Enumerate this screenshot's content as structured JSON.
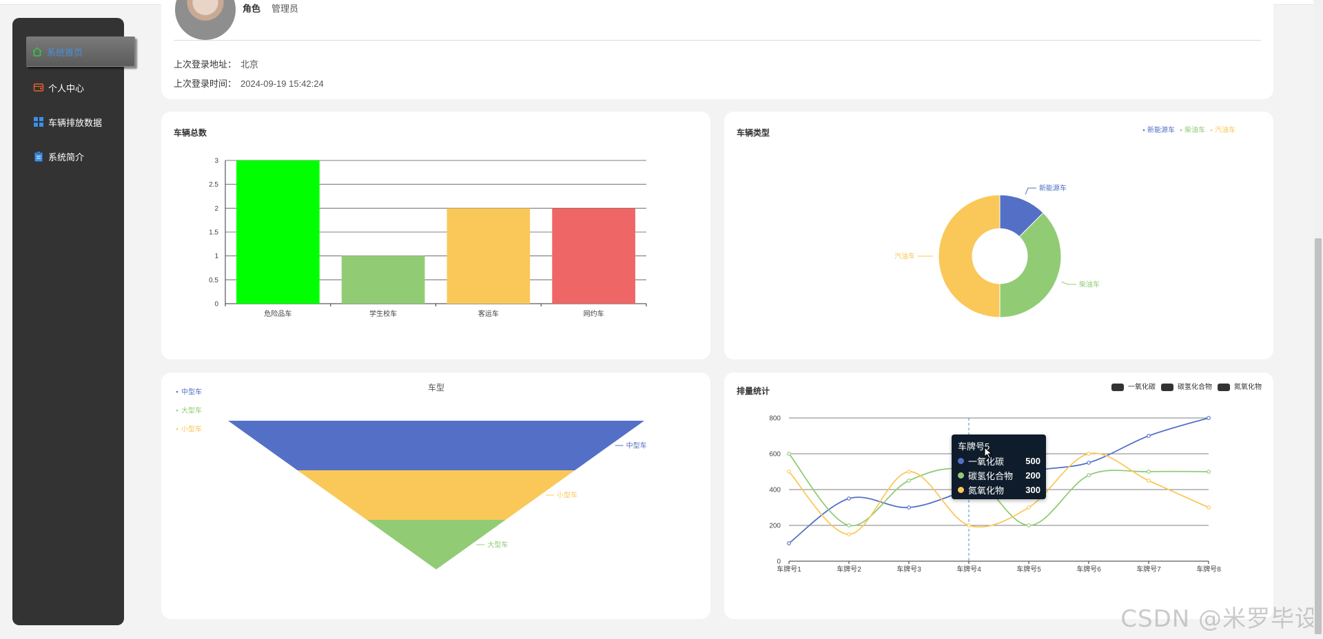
{
  "sidebar": {
    "items": [
      {
        "label": "系统首页",
        "icon": "home-icon",
        "active": true
      },
      {
        "label": "个人中心",
        "icon": "wallet-icon",
        "active": false
      },
      {
        "label": "车辆排放数据",
        "icon": "grid-icon",
        "active": false
      },
      {
        "label": "系统简介",
        "icon": "clipboard-icon",
        "active": false
      }
    ]
  },
  "profile": {
    "role_label": "角色",
    "role_value": "管理员",
    "last_login_address_label": "上次登录地址：",
    "last_login_address": "北京",
    "last_login_time_label": "上次登录时间：",
    "last_login_time": "2024-09-19 15:42:24"
  },
  "charts": {
    "vehicle_total": {
      "title": "车辆总数"
    },
    "vehicle_type": {
      "title": "车辆类型"
    },
    "model": {
      "title": "车型"
    },
    "emission": {
      "title": "排量统计"
    }
  },
  "chart_data": [
    {
      "type": "bar",
      "title": "车辆总数",
      "categories": [
        "危险品车",
        "学生校车",
        "客运车",
        "网约车"
      ],
      "values": [
        3,
        1,
        2,
        2
      ],
      "colors": [
        "#00ff00",
        "#91cc75",
        "#fac858",
        "#ee6666"
      ],
      "yticks": [
        "0",
        "0.5",
        "1",
        "1.5",
        "2",
        "2.5",
        "3"
      ],
      "ylim": [
        0,
        3
      ]
    },
    {
      "type": "pie",
      "title": "车辆类型",
      "legend": [
        "新能源车",
        "柴油车",
        "汽油车"
      ],
      "values": [
        1,
        3,
        4
      ],
      "colors": [
        "#5470c6",
        "#91cc75",
        "#fac858"
      ],
      "legend_position": "top-right"
    },
    {
      "type": "funnel",
      "title": "车型",
      "legend": [
        "中型车",
        "大型车",
        "小型车"
      ],
      "stages": [
        {
          "name": "中型车",
          "value": 3,
          "color": "#5470c6"
        },
        {
          "name": "小型车",
          "value": 2,
          "color": "#fac858"
        },
        {
          "name": "大型车",
          "value": 1,
          "color": "#91cc75"
        }
      ],
      "legend_position": "top-left"
    },
    {
      "type": "line",
      "title": "排量统计",
      "categories": [
        "车牌号1",
        "车牌号2",
        "车牌号3",
        "车牌号4",
        "车牌号5",
        "车牌号6",
        "车牌号7",
        "车牌号8"
      ],
      "yticks": [
        "0",
        "200",
        "400",
        "600",
        "800"
      ],
      "ylim": [
        0,
        800
      ],
      "series": [
        {
          "name": "一氧化碳",
          "color": "#5470c6",
          "values": [
            100,
            350,
            300,
            400,
            500,
            550,
            700,
            800
          ]
        },
        {
          "name": "碳氢化合物",
          "color": "#91cc75",
          "values": [
            600,
            200,
            450,
            500,
            200,
            480,
            500,
            500
          ]
        },
        {
          "name": "氮氧化物",
          "color": "#fac858",
          "values": [
            500,
            150,
            500,
            200,
            300,
            600,
            450,
            300
          ]
        }
      ],
      "legend_position": "top-right",
      "tooltip": {
        "title": "车牌号5",
        "rows": [
          {
            "name": "一氧化碳",
            "value": "500",
            "color": "#5470c6"
          },
          {
            "name": "碳氢化合物",
            "value": "200",
            "color": "#91cc75"
          },
          {
            "name": "氮氧化物",
            "value": "300",
            "color": "#fac858"
          }
        ]
      }
    }
  ],
  "watermark": "CSDN @米罗毕设"
}
